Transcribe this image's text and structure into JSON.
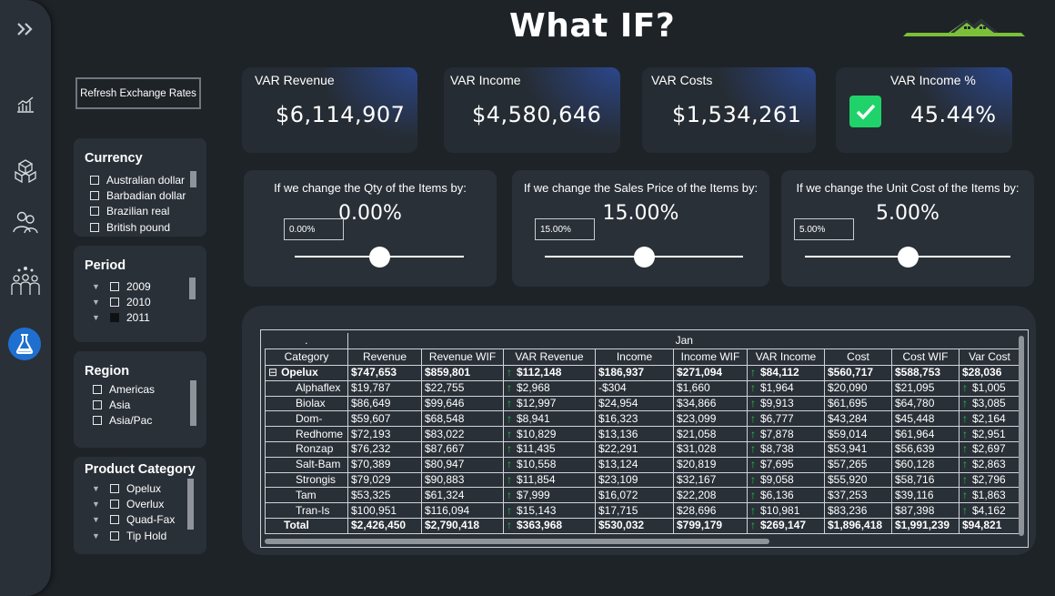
{
  "header": {
    "title": "What IF?"
  },
  "sidebar": {
    "items": [
      {
        "icon": "chevrons-right-icon"
      },
      {
        "icon": "chart-icon"
      },
      {
        "icon": "cubes-icon"
      },
      {
        "icon": "users-icon"
      },
      {
        "icon": "team-icon"
      },
      {
        "icon": "flask-icon",
        "active": true
      }
    ]
  },
  "refresh_button": {
    "label": "Refresh Exchange Rates"
  },
  "slicers": {
    "currency": {
      "title": "Currency",
      "items": [
        "Australian dollar",
        "Barbadian dollar",
        "Brazilian real",
        "British pound"
      ]
    },
    "period": {
      "title": "Period",
      "items": [
        "2009",
        "2010",
        "2011"
      ]
    },
    "region": {
      "title": "Region",
      "items": [
        "Americas",
        "Asia",
        "Asia/Pac"
      ]
    },
    "product_category": {
      "title": "Product Category",
      "items": [
        "Opelux",
        "Overlux",
        "Quad-Fax",
        "Tip Hold"
      ]
    }
  },
  "kpis": [
    {
      "label": "VAR Revenue",
      "value": "$6,114,907"
    },
    {
      "label": "VAR Income",
      "value": "$4,580,646"
    },
    {
      "label": "VAR Costs",
      "value": "$1,534,261"
    },
    {
      "label": "VAR Income %",
      "value": "45.44%"
    }
  ],
  "what_if": [
    {
      "label": "If we change the Qty of the Items by:",
      "value": "0.00%",
      "input": "0.00%",
      "slider_position": 0.5
    },
    {
      "label": "If we change the Sales Price of the Items by:",
      "value": "15.00%",
      "input": "15.00%",
      "slider_position": 0.5
    },
    {
      "label": "If we change the Unit Cost of the Items by:",
      "value": "5.00%",
      "input": "5.00%",
      "slider_position": 0.5
    }
  ],
  "table": {
    "corner": ".",
    "month": "Jan",
    "columns": [
      "Category",
      "Revenue",
      "Revenue WIF",
      "VAR Revenue",
      "Income",
      "Income WIF",
      "VAR Income",
      "Cost",
      "Cost WIF",
      "Var Cost"
    ],
    "group": {
      "expander": "⊟",
      "name": "Opelux",
      "values": [
        "$747,653",
        "$859,801",
        "$112,148",
        "$186,937",
        "$271,094",
        "$84,112",
        "$560,717",
        "$588,753",
        "$28,036"
      ]
    },
    "rows": [
      {
        "name": "Alphaflex",
        "values": [
          "$19,787",
          "$22,755",
          "$2,968",
          "-$304",
          "$1,660",
          "$1,964",
          "$20,090",
          "$21,095",
          "$1,005"
        ]
      },
      {
        "name": "Biolax",
        "values": [
          "$86,649",
          "$99,646",
          "$12,997",
          "$24,954",
          "$34,866",
          "$9,913",
          "$61,695",
          "$64,780",
          "$3,085"
        ]
      },
      {
        "name": "Dom-",
        "values": [
          "$59,607",
          "$68,548",
          "$8,941",
          "$16,323",
          "$23,099",
          "$6,777",
          "$43,284",
          "$45,448",
          "$2,164"
        ]
      },
      {
        "name": "Redhome",
        "values": [
          "$72,193",
          "$83,022",
          "$10,829",
          "$13,136",
          "$21,058",
          "$7,878",
          "$59,014",
          "$61,964",
          "$2,951"
        ]
      },
      {
        "name": "Ronzap",
        "values": [
          "$76,232",
          "$87,667",
          "$11,435",
          "$22,291",
          "$31,028",
          "$8,738",
          "$53,941",
          "$56,639",
          "$2,697"
        ]
      },
      {
        "name": "Salt-Bam",
        "values": [
          "$70,389",
          "$80,947",
          "$10,558",
          "$13,124",
          "$20,819",
          "$7,695",
          "$57,265",
          "$60,128",
          "$2,863"
        ]
      },
      {
        "name": "Strongis",
        "values": [
          "$79,029",
          "$90,883",
          "$11,854",
          "$23,109",
          "$32,167",
          "$9,058",
          "$55,920",
          "$58,716",
          "$2,796"
        ]
      },
      {
        "name": "Tam",
        "values": [
          "$53,325",
          "$61,324",
          "$7,999",
          "$16,072",
          "$22,208",
          "$6,136",
          "$37,253",
          "$39,116",
          "$1,863"
        ]
      },
      {
        "name": "Tran-Is",
        "values": [
          "$100,951",
          "$116,094",
          "$15,143",
          "$17,715",
          "$28,696",
          "$10,981",
          "$83,236",
          "$87,398",
          "$4,162"
        ]
      }
    ],
    "total": {
      "name": "Total",
      "values": [
        "$2,426,450",
        "$2,790,418",
        "$363,968",
        "$530,032",
        "$799,179",
        "$269,147",
        "$1,896,418",
        "$1,991,239",
        "$94,821"
      ]
    }
  }
}
